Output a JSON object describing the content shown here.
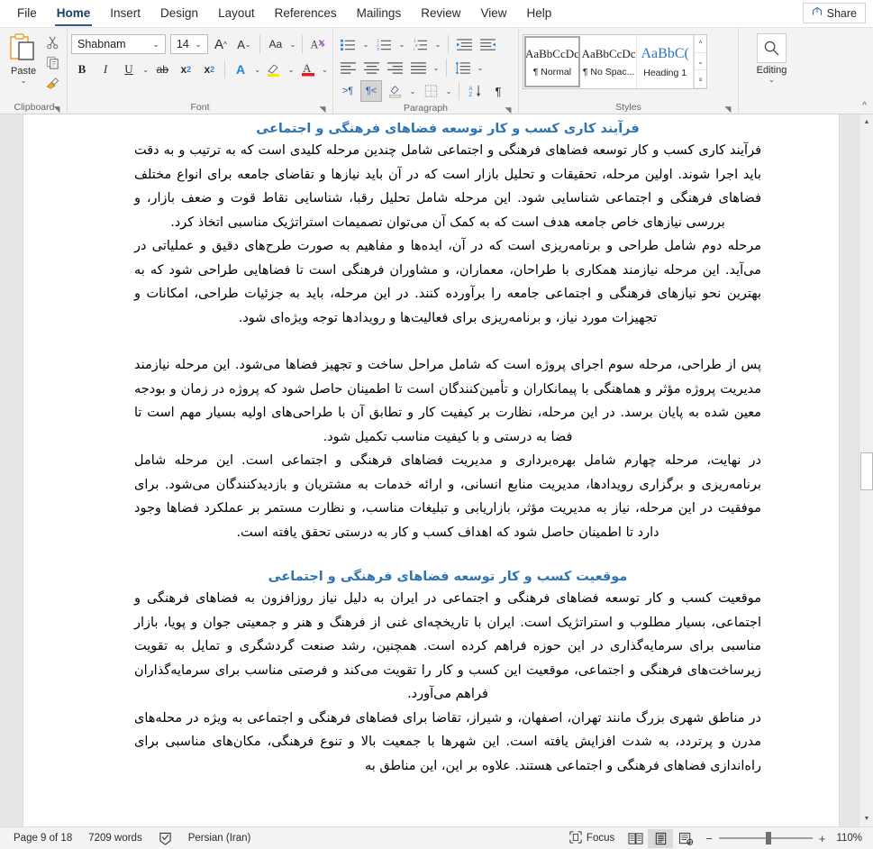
{
  "tabs": [
    {
      "label": "File",
      "active": false
    },
    {
      "label": "Home",
      "active": true
    },
    {
      "label": "Insert",
      "active": false
    },
    {
      "label": "Design",
      "active": false
    },
    {
      "label": "Layout",
      "active": false
    },
    {
      "label": "References",
      "active": false
    },
    {
      "label": "Mailings",
      "active": false
    },
    {
      "label": "Review",
      "active": false
    },
    {
      "label": "View",
      "active": false
    },
    {
      "label": "Help",
      "active": false
    }
  ],
  "share": {
    "label": "Share",
    "icon": "share-icon"
  },
  "ribbon": {
    "clipboard": {
      "group_label": "Clipboard",
      "paste_label": "Paste",
      "paste_chevron": "⌄",
      "cut_icon": "scissors-icon",
      "copy_icon": "copy-icon",
      "format_painter_icon": "format-painter-icon",
      "dialog_launcher": "⌐"
    },
    "font": {
      "group_label": "Font",
      "font_name": "Shabnam",
      "font_size": "14",
      "grow_font": "A",
      "shrink_font": "A",
      "change_case": "Aa",
      "clear_formatting": "A",
      "bold": "B",
      "italic": "I",
      "underline": "U",
      "strikethrough": "ab",
      "subscript": "x",
      "superscript": "x",
      "text_effects": "A",
      "highlight": "A",
      "font_color": "A",
      "dialog_launcher": "⌐"
    },
    "paragraph": {
      "group_label": "Paragraph",
      "bullets": "bullet-list-icon",
      "numbering": "numbered-list-icon",
      "multilevel": "multilevel-list-icon",
      "decrease_indent": "decrease-indent-icon",
      "increase_indent": "increase-indent-icon",
      "align_left": "align-left-icon",
      "align_center": "align-center-icon",
      "align_right": "align-right-icon",
      "justify": "justify-icon",
      "line_spacing": "line-spacing-icon",
      "ltr_text": ">¶",
      "rtl_text": "¶<",
      "shading": "shading-icon",
      "borders": "borders-icon",
      "sort": "sort-icon",
      "show_marks": "¶",
      "dialog_launcher": "⌐"
    },
    "styles": {
      "group_label": "Styles",
      "items": [
        {
          "preview": "AaBbCcDc",
          "name": "¶ Normal",
          "selected": true
        },
        {
          "preview": "AaBbCcDc",
          "name": "¶ No Spac...",
          "selected": false
        },
        {
          "preview": "AaBbC(",
          "name": "Heading 1",
          "selected": false
        }
      ],
      "dialog_launcher": "⌐"
    },
    "editing": {
      "group_label": "Editing",
      "label": "Editing",
      "icon": "search-icon",
      "chevron": "⌄"
    },
    "collapse_ribbon": "^"
  },
  "document": {
    "blocks": [
      {
        "type": "heading",
        "text": "فرآیند کاری کسب و کار توسعه فضاهای فرهنگی و اجتماعی"
      },
      {
        "type": "paragraph",
        "text": "فرآیند کاری کسب و کار توسعه فضاهای فرهنگی و اجتماعی شامل چندین مرحله کلیدی است که به ترتیب و به دقت باید اجرا شوند. اولین مرحله، تحقیقات و تحلیل بازار است که در آن باید نیازها و تقاضای جامعه برای انواع مختلف فضاهای فرهنگی و اجتماعی شناسایی شود. این مرحله شامل تحلیل رقبا، شناسایی نقاط قوت و ضعف بازار، و بررسی نیازهای خاص جامعه هدف است که به کمک آن می‌توان تصمیمات استراتژیک مناسبی اتخاذ کرد."
      },
      {
        "type": "paragraph",
        "text": "مرحله دوم شامل طراحی و برنامه‌ریزی است که در آن، ایده‌ها و مفاهیم به صورت طرح‌های دقیق و عملیاتی در می‌آید. این مرحله نیازمند همکاری با طراحان، معماران، و مشاوران فرهنگی است تا فضاهایی طراحی شود که به بهترین نحو نیازهای فرهنگی و اجتماعی جامعه را برآورده کنند. در این مرحله، باید به جزئیات طراحی، امکانات و تجهیزات مورد نیاز، و برنامه‌ریزی برای فعالیت‌ها و رویدادها توجه ویژه‌ای شود."
      },
      {
        "type": "spacer"
      },
      {
        "type": "paragraph",
        "text": "پس از طراحی، مرحله سوم اجرای پروژه است که شامل مراحل ساخت و تجهیز فضاها می‌شود. این مرحله نیازمند مدیریت پروژه مؤثر و هماهنگی با پیمانکاران و تأمین‌کنندگان است تا اطمینان حاصل شود که پروژه در زمان و بودجه معین شده به پایان برسد. در این مرحله، نظارت بر کیفیت کار و تطابق آن با طراحی‌های اولیه بسیار مهم است تا فضا به درستی و با کیفیت مناسب تکمیل شود."
      },
      {
        "type": "paragraph",
        "text": "در نهایت، مرحله چهارم شامل بهره‌برداری و مدیریت فضاهای فرهنگی و اجتماعی است. این مرحله شامل برنامه‌ریزی و برگزاری رویدادها، مدیریت منابع انسانی، و ارائه خدمات به مشتریان و بازدیدکنندگان می‌شود. برای موفقیت در این مرحله، نیاز به مدیریت مؤثر، بازاریابی و تبلیغات مناسب، و نظارت مستمر بر عملکرد فضاها وجود دارد تا اطمینان حاصل شود که اهداف کسب و کار به درستی تحقق یافته است."
      },
      {
        "type": "spacer"
      },
      {
        "type": "heading",
        "text": "موقعیت کسب و کار توسعه فضاهای فرهنگی و اجتماعی"
      },
      {
        "type": "paragraph",
        "text": "موقعیت کسب و کار توسعه فضاهای فرهنگی و اجتماعی در ایران به دلیل نیاز روزافزون به فضاهای فرهنگی و اجتماعی، بسیار مطلوب و استراتژیک است. ایران با تاریخچه‌ای غنی از فرهنگ و هنر و جمعیتی جوان و پویا، بازار مناسبی برای سرمایه‌گذاری در این حوزه فراهم کرده است. همچنین، رشد صنعت گردشگری و تمایل به تقویت زیرساخت‌های فرهنگی و اجتماعی، موقعیت این کسب و کار را تقویت می‌کند و فرصتی مناسب برای سرمایه‌گذاران فراهم می‌آورد."
      },
      {
        "type": "paragraph",
        "text": "در مناطق شهری بزرگ مانند تهران، اصفهان، و شیراز، تقاضا برای فضاهای فرهنگی و اجتماعی به ویژه در محله‌های مدرن و پرتردد، به شدت افزایش یافته است. این شهرها با جمعیت بالا و تنوع فرهنگی، مکان‌های مناسبی برای راه‌اندازی فضاهای فرهنگی و اجتماعی هستند. علاوه بر این، این مناطق به"
      }
    ],
    "heading_color": "#2e74b5"
  },
  "scrollbar": {
    "up_arrow": "▲",
    "down_arrow": "▼",
    "split_handle": "split-window-handle"
  },
  "statusbar": {
    "page": "Page 9 of 18",
    "words": "7209 words",
    "proofing_icon": "proofing-errors-icon",
    "language": "Persian (Iran)",
    "focus_label": "Focus",
    "focus_icon": "focus-mode-icon",
    "view_read": "read-mode-icon",
    "view_print": "print-layout-icon",
    "view_web": "web-layout-icon",
    "zoom_out": "−",
    "zoom_in": "+",
    "zoom_level": "110%"
  }
}
